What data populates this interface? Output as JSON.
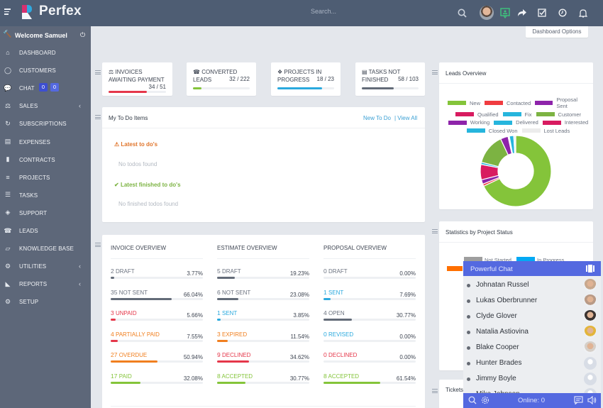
{
  "app": {
    "brand": "Perfex",
    "search_placeholder": "Search...",
    "dashboard_options_label": "Dashboard Options"
  },
  "colors": {
    "header_bg": "#4e5d73",
    "sidebar_bg": "#5d6779",
    "accent_blue": "#3ba0d4",
    "chat_accent": "#5469e0",
    "danger": "#e5374a",
    "warning": "#f07f1f",
    "success": "#84c43a",
    "gray": "#636b78",
    "info": "#2aa9de"
  },
  "header_icons": [
    "search-icon",
    "user-avatar",
    "qr-chat-icon",
    "share-icon",
    "tasks-check-icon",
    "clock-icon",
    "bell-icon"
  ],
  "sidebar": {
    "welcome": "Welcome Samuel",
    "items": [
      {
        "label": "DASHBOARD",
        "icon": "home-icon"
      },
      {
        "label": "CUSTOMERS",
        "icon": "user-icon"
      },
      {
        "label": "CHAT",
        "icon": "chat-icon",
        "badges": [
          "0",
          "0"
        ]
      },
      {
        "label": "SALES",
        "icon": "balance-scale-icon",
        "has_submenu": true
      },
      {
        "label": "SUBSCRIPTIONS",
        "icon": "refresh-icon"
      },
      {
        "label": "EXPENSES",
        "icon": "file-text-icon"
      },
      {
        "label": "CONTRACTS",
        "icon": "file-icon"
      },
      {
        "label": "PROJECTS",
        "icon": "bars-icon"
      },
      {
        "label": "TASKS",
        "icon": "tasks-icon"
      },
      {
        "label": "SUPPORT",
        "icon": "ticket-icon"
      },
      {
        "label": "LEADS",
        "icon": "tty-icon"
      },
      {
        "label": "KNOWLEDGE BASE",
        "icon": "folder-open-icon"
      },
      {
        "label": "UTILITIES",
        "icon": "cogs-icon",
        "has_submenu": true
      },
      {
        "label": "REPORTS",
        "icon": "area-chart-icon",
        "has_submenu": true
      },
      {
        "label": "SETUP",
        "icon": "cog-icon"
      }
    ]
  },
  "stats": [
    {
      "title_line1": "INVOICES",
      "title_line2": "AWAITING PAYMENT",
      "value": "34 / 51",
      "progress": 0.667,
      "color": "#e5374a",
      "icon": "balance-scale-icon"
    },
    {
      "title_line1": "CONVERTED",
      "title_line2": "LEADS",
      "value": "32 / 222",
      "progress": 0.144,
      "color": "#84c43a",
      "icon": "tty-icon"
    },
    {
      "title_line1": "PROJECTS IN",
      "title_line2": "PROGRESS",
      "value": "18 / 23",
      "progress": 0.783,
      "color": "#2aa9de",
      "icon": "cubes-icon"
    },
    {
      "title_line1": "TASKS NOT",
      "title_line2": "FINISHED",
      "value": "58 / 103",
      "progress": 0.563,
      "color": "#636b78",
      "icon": "tasks-icon"
    }
  ],
  "todo": {
    "title": "My To Do Items",
    "new_link": "New To Do",
    "view_all_link": "| View All",
    "latest_heading": "Latest to do's",
    "latest_empty": "No todos found",
    "finished_heading": "Latest finished to do's",
    "finished_empty": "No finished todos found"
  },
  "overview": [
    {
      "title": "INVOICE OVERVIEW",
      "rows": [
        {
          "count": "2",
          "label": "DRAFT",
          "pct": "3.77%",
          "value": 3.77,
          "color": "#636b78"
        },
        {
          "count": "35",
          "label": "NOT SENT",
          "pct": "66.04%",
          "value": 66.04,
          "color": "#636b78"
        },
        {
          "count": "3",
          "label": "UNPAID",
          "pct": "5.66%",
          "value": 5.66,
          "color": "#e5374a"
        },
        {
          "count": "4",
          "label": "PARTIALLY PAID",
          "pct": "7.55%",
          "value": 7.55,
          "color": "#f07f1f",
          "bar_color": "#e5374a"
        },
        {
          "count": "27",
          "label": "OVERDUE",
          "pct": "50.94%",
          "value": 50.94,
          "color": "#f07f1f"
        },
        {
          "count": "17",
          "label": "PAID",
          "pct": "32.08%",
          "value": 32.08,
          "color": "#84c43a"
        }
      ]
    },
    {
      "title": "ESTIMATE OVERVIEW",
      "rows": [
        {
          "count": "5",
          "label": "DRAFT",
          "pct": "19.23%",
          "value": 19.23,
          "color": "#636b78"
        },
        {
          "count": "6",
          "label": "NOT SENT",
          "pct": "23.08%",
          "value": 23.08,
          "color": "#636b78"
        },
        {
          "count": "1",
          "label": "SENT",
          "pct": "3.85%",
          "value": 3.85,
          "color": "#2aa9de"
        },
        {
          "count": "3",
          "label": "EXPIRED",
          "pct": "11.54%",
          "value": 11.54,
          "color": "#f07f1f"
        },
        {
          "count": "9",
          "label": "DECLINED",
          "pct": "34.62%",
          "value": 34.62,
          "color": "#e5374a"
        },
        {
          "count": "8",
          "label": "ACCEPTED",
          "pct": "30.77%",
          "value": 30.77,
          "color": "#84c43a"
        }
      ]
    },
    {
      "title": "PROPOSAL OVERVIEW",
      "rows": [
        {
          "count": "0",
          "label": "DRAFT",
          "pct": "0.00%",
          "value": 0,
          "color": "#636b78"
        },
        {
          "count": "1",
          "label": "SENT",
          "pct": "7.69%",
          "value": 7.69,
          "color": "#2aa9de"
        },
        {
          "count": "4",
          "label": "OPEN",
          "pct": "30.77%",
          "value": 30.77,
          "color": "#636b78"
        },
        {
          "count": "0",
          "label": "REVISED",
          "pct": "0.00%",
          "value": 0,
          "color": "#2aa9de"
        },
        {
          "count": "0",
          "label": "DECLINED",
          "pct": "0.00%",
          "value": 0,
          "color": "#e5374a"
        },
        {
          "count": "8",
          "label": "ACCEPTED",
          "pct": "61.54%",
          "value": 61.54,
          "color": "#84c43a"
        }
      ]
    }
  ],
  "leads_overview": {
    "title": "Leads Overview",
    "legend": [
      {
        "label": "New",
        "color": "#84c43a"
      },
      {
        "label": "Contacted",
        "color": "#f03c40"
      },
      {
        "label": "Proposal Sent",
        "color": "#8e24aa"
      },
      {
        "label": "Qualified",
        "color": "#d81b60"
      },
      {
        "label": "Fix",
        "color": "#26b5dd"
      },
      {
        "label": "Customer",
        "color": "#7cb342"
      },
      {
        "label": "Working",
        "color": "#8e24aa"
      },
      {
        "label": "Delivered",
        "color": "#26b5dd"
      },
      {
        "label": "Interested",
        "color": "#d81b60"
      },
      {
        "label": "Closed Won",
        "color": "#26b5dd"
      },
      {
        "label": "Lost Leads",
        "color": "#ececec"
      }
    ],
    "slices": [
      {
        "label": "New",
        "value": 68,
        "color": "#84c43a"
      },
      {
        "label": "Contacted",
        "value": 1,
        "color": "#f03c40"
      },
      {
        "label": "Proposal Sent",
        "value": 2,
        "color": "#8e24aa"
      },
      {
        "label": "Qualified",
        "value": 7,
        "color": "#d81b60"
      },
      {
        "label": "Fix",
        "value": 1,
        "color": "#26b5dd"
      },
      {
        "label": "Customer",
        "value": 14,
        "color": "#7cb342"
      },
      {
        "label": "Working",
        "value": 3.5,
        "color": "#8e24aa"
      },
      {
        "label": "Delivered",
        "value": 0.3,
        "color": "#ffffff"
      },
      {
        "label": "Interested",
        "value": 0.3,
        "color": "#ffffff"
      },
      {
        "label": "Closed Won",
        "value": 2,
        "color": "#26b5dd"
      },
      {
        "label": "Lost Leads",
        "value": 0.9,
        "color": "#ececec"
      }
    ]
  },
  "project_stats": {
    "title": "Statistics by Project Status",
    "legend": [
      {
        "label": "Not Started",
        "color": "#9e9e9e"
      },
      {
        "label": "In Progress",
        "color": "#03a9f4"
      }
    ]
  },
  "tickets": {
    "title": "Tickets"
  },
  "chat": {
    "title": "Powerful Chat",
    "online": "Online: 0",
    "users": [
      {
        "name": "Johnatan Russel",
        "avatar": "photo"
      },
      {
        "name": "Lukas Oberbrunner",
        "avatar": "photo"
      },
      {
        "name": "Clyde Glover",
        "avatar": "photo"
      },
      {
        "name": "Natalia Astiovina",
        "avatar": "photo"
      },
      {
        "name": "Blake Cooper",
        "avatar": "photo"
      },
      {
        "name": "Hunter Brades",
        "avatar": "placeholder"
      },
      {
        "name": "Jimmy Boyle",
        "avatar": "placeholder"
      },
      {
        "name": "Mike Johnson",
        "avatar": "placeholder"
      }
    ]
  }
}
